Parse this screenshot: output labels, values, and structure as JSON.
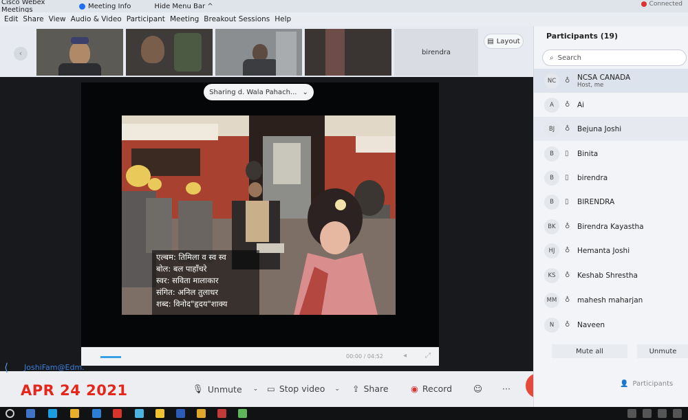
{
  "titlebar": {
    "app_name": "Cisco Webex Meetings",
    "meeting_info": "Meeting Info",
    "hide_menu": "Hide Menu Bar ^",
    "connection": "Connected"
  },
  "menu": [
    "Edit",
    "Share",
    "View",
    "Audio & Video",
    "Participant",
    "Meeting",
    "Breakout Sessions",
    "Help"
  ],
  "filmstrip": {
    "name_tile": "birendra",
    "layout_label": "Layout"
  },
  "share": {
    "pill_label": "Sharing d. Wala Pahach..."
  },
  "video": {
    "caption_lines": [
      "एल्बम: तिमिला व स्व स्व",
      "बोल: बल पाहाँचरे",
      "स्वर: सविता मालाकार",
      "संगित: अनिल तुलाधर",
      "शब्द: विनोद\"हृदय\"शाक्य"
    ],
    "time": "00:00 / 04:52"
  },
  "controls": {
    "unmute": "Unmute",
    "stop_video": "Stop video",
    "share": "Share",
    "record": "Record",
    "more": "···",
    "participants": "Participants"
  },
  "overlay": {
    "watermark": "JoshiFam@Edm.",
    "date": "APR 24 2021"
  },
  "participants": {
    "title": "Participants (19)",
    "search_placeholder": "Search",
    "list": [
      {
        "initials": "NC",
        "name": "NCSA CANADA",
        "sub": "Host, me",
        "mic": "mic"
      },
      {
        "initials": "A",
        "name": "Ai",
        "sub": "",
        "mic": "mic"
      },
      {
        "initials": "BJ",
        "name": "Bejuna Joshi",
        "sub": "",
        "mic": "mic"
      },
      {
        "initials": "B",
        "name": "Binita",
        "sub": "",
        "mic": "phone"
      },
      {
        "initials": "B",
        "name": "birendra",
        "sub": "",
        "mic": "phone"
      },
      {
        "initials": "B",
        "name": "BIRENDRA",
        "sub": "",
        "mic": "phone"
      },
      {
        "initials": "BK",
        "name": "Birendra Kayastha",
        "sub": "",
        "mic": "mic"
      },
      {
        "initials": "HJ",
        "name": "Hemanta Joshi",
        "sub": "",
        "mic": "mic"
      },
      {
        "initials": "KS",
        "name": "Keshab Shrestha",
        "sub": "",
        "mic": "mic"
      },
      {
        "initials": "MM",
        "name": "mahesh maharjan",
        "sub": "",
        "mic": "mic"
      },
      {
        "initials": "N",
        "name": "Naveen",
        "sub": "",
        "mic": "mic"
      }
    ],
    "mute_all": "Mute all",
    "unmute_all": "Unmute"
  },
  "colors": {
    "leave_button": "#e5493c",
    "date_overlay": "#e5261b",
    "accent_blue": "#1f6ef3"
  }
}
